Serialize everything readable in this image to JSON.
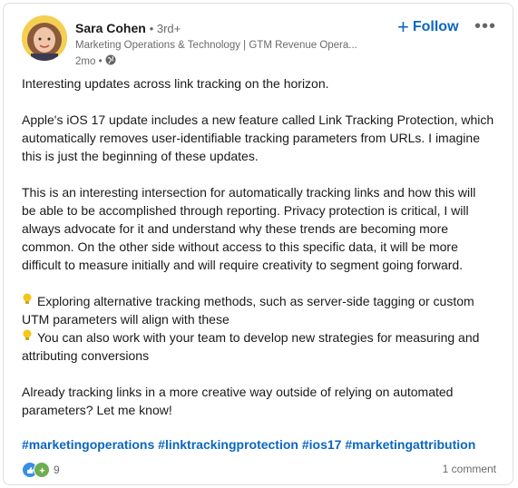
{
  "author": {
    "name": "Sara Cohen",
    "degree": "• 3rd+",
    "headline": "Marketing Operations & Technology | GTM Revenue Opera...",
    "time": "2mo •",
    "visibility_icon": "globe-icon"
  },
  "actions": {
    "follow_label": "Follow",
    "more_label": "•••"
  },
  "post": {
    "p1": "Interesting updates across link tracking on the horizon.",
    "p2_l1": "Apple's iOS 17 update includes a new feature called Link Tracking Protection, which",
    "p2_l2": "automatically removes user-identifiable tracking parameters from URLs. I imagine",
    "p2_l3": "this is just the beginning of these updates.",
    "p3_l1": "This is an interesting intersection for automatically tracking links and how this will",
    "p3_l2": "be able to be accomplished through reporting. Privacy protection is critical, I will",
    "p3_l3": "always advocate for it and understand why these trends are becoming more",
    "p3_l4": "common. On the other side without access to this specific data, it will be more",
    "p3_l5": "difficult to measure initially and will require creativity to segment going forward.",
    "b1_l1": "Exploring alternative tracking methods, such as server-side tagging or custom",
    "b1_l2": "UTM parameters will align with these",
    "b2_l1": "You can also work with your team to develop new strategies for measuring and",
    "b2_l2": "attributing conversions",
    "p4_l1": "Already tracking links in a more creative way outside of relying on automated",
    "p4_l2": "parameters? Let me know!",
    "bullet_icon": "lightbulb-icon"
  },
  "hashtags": [
    "#marketingoperations",
    "#linktrackingprotection",
    "#ios17",
    "#marketingattribution"
  ],
  "social": {
    "reaction_count": "9",
    "comments": "1 comment"
  },
  "colors": {
    "link_blue": "#0a66c2",
    "like_blue": "#378fe9",
    "celebrate_green": "#6dae4f",
    "bulb_yellow": "#f5c518"
  }
}
